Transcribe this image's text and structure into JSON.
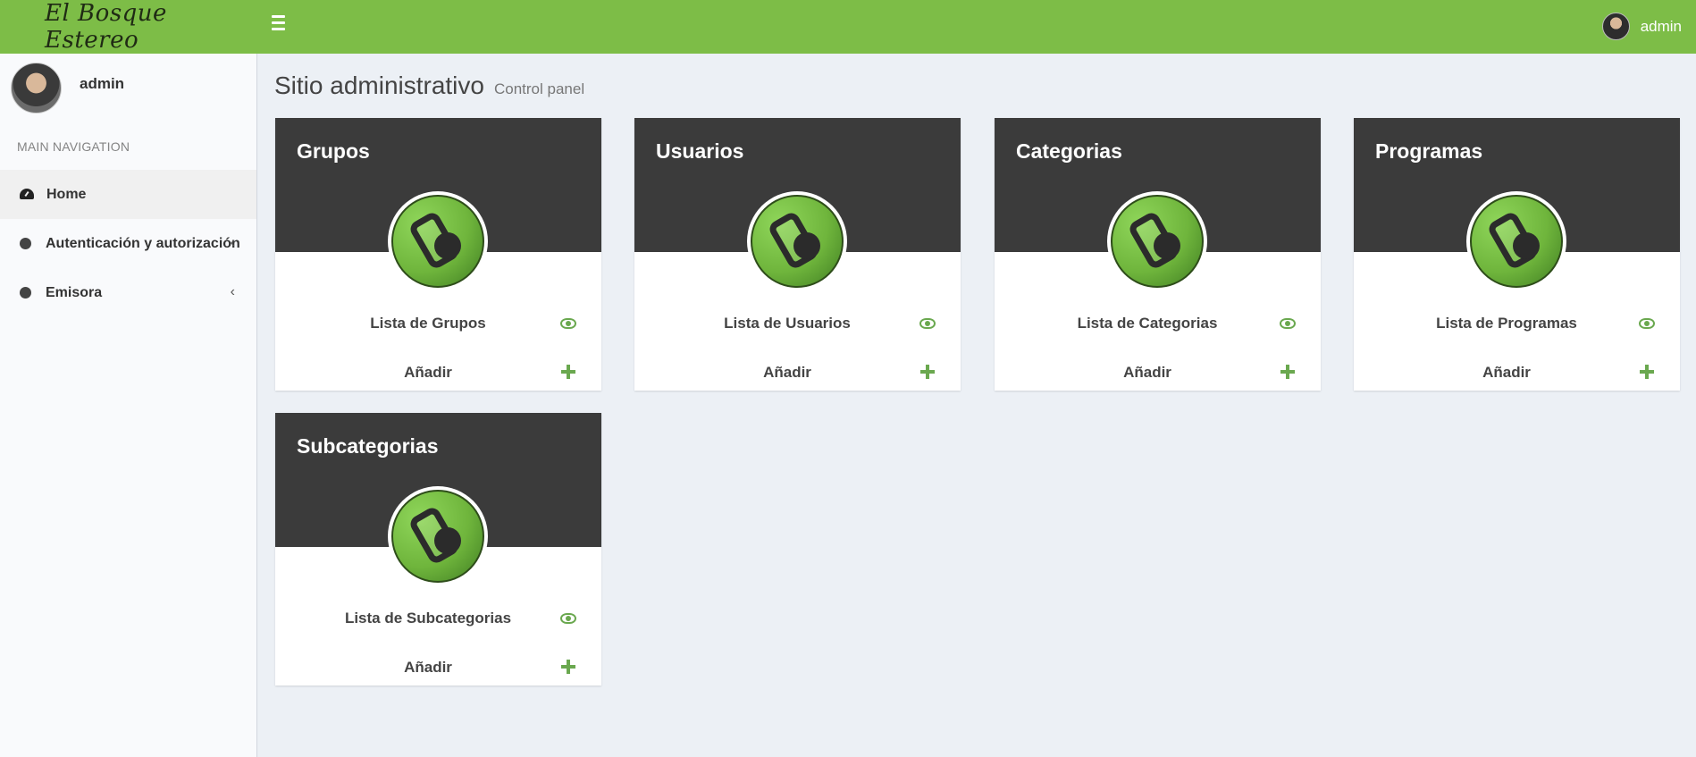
{
  "brand": {
    "logo_text": "El Bosque Estereo",
    "accent": "#7dbd47"
  },
  "header": {
    "user_name": "admin"
  },
  "sidebar": {
    "user_name": "admin",
    "nav_header": "MAIN NAVIGATION",
    "items": [
      {
        "label": "Home",
        "icon": "dashboard-icon",
        "active": true
      },
      {
        "label": "Autenticación y autorización",
        "icon": "circle-icon"
      },
      {
        "label": "Emisora",
        "icon": "circle-icon"
      }
    ]
  },
  "page": {
    "title": "Sitio administrativo",
    "subtitle": "Control panel"
  },
  "cards": [
    {
      "title": "Grupos",
      "list_label": "Lista de Grupos",
      "add_label": "Añadir"
    },
    {
      "title": "Usuarios",
      "list_label": "Lista de Usuarios",
      "add_label": "Añadir"
    },
    {
      "title": "Categorias",
      "list_label": "Lista de Categorias",
      "add_label": "Añadir"
    },
    {
      "title": "Programas",
      "list_label": "Lista de Programas",
      "add_label": "Añadir"
    },
    {
      "title": "Subcategorias",
      "list_label": "Lista de Subcategorias",
      "add_label": "Añadir"
    }
  ]
}
